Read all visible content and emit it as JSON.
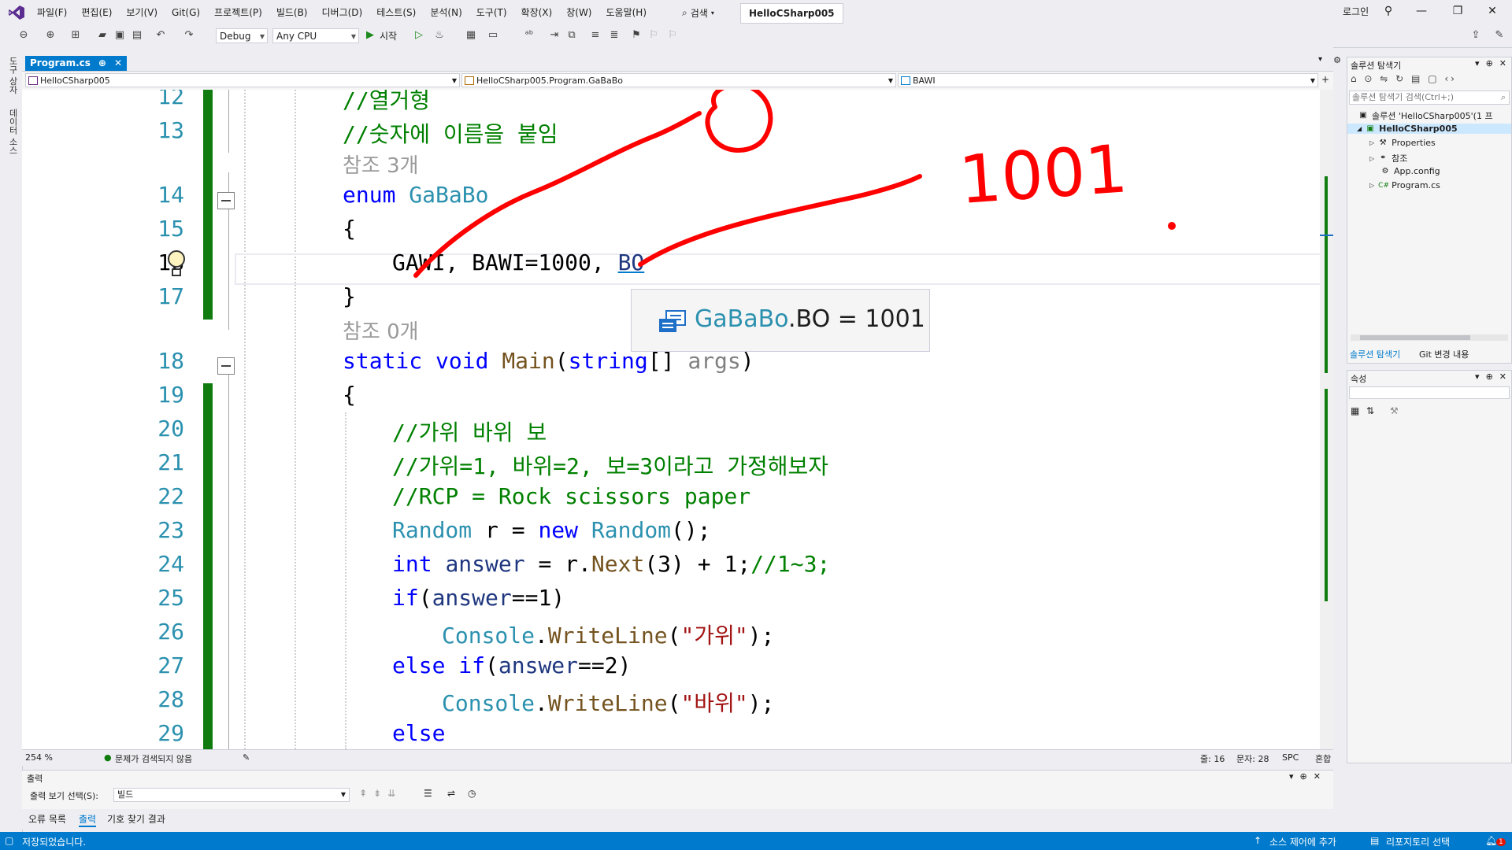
{
  "menu": {
    "items": [
      "파일(F)",
      "편집(E)",
      "보기(V)",
      "Git(G)",
      "프로젝트(P)",
      "빌드(B)",
      "디버그(D)",
      "테스트(S)",
      "분석(N)",
      "도구(T)",
      "확장(X)",
      "창(W)",
      "도움말(H)"
    ],
    "search_label": "검색",
    "solution_name": "HelloCSharp005",
    "login": "로그인"
  },
  "toolbar": {
    "config": "Debug",
    "platform": "Any CPU",
    "start_label": "시작"
  },
  "side_strip": [
    "도구 상자",
    "데이터 소스"
  ],
  "editor": {
    "tab_label": "Program.cs",
    "tab_pin": "⊕",
    "tab_close": "✕",
    "nav_project": "HelloCSharp005",
    "nav_class": "HelloCSharp005.Program.GaBaBo",
    "nav_member": "BAWI",
    "ref_3": "참조 3개",
    "ref_0": "참조 0개",
    "line_numbers": [
      "12",
      "13",
      "14",
      "15",
      "16",
      "17",
      "18",
      "19",
      "20",
      "21",
      "22",
      "23",
      "24",
      "25",
      "26",
      "27",
      "28",
      "29"
    ],
    "lines": {
      "l12": "//열거형",
      "l13": "//숫자에 이름을 붙임",
      "l14_kw": "enum",
      "l14_ty": "GaBaBo",
      "l15": "{",
      "l16_a": "GAWI, BAWI=1000, ",
      "l16_b": "BO",
      "l17": "}",
      "l18_kw1": "static",
      "l18_kw2": "void",
      "l18_me": "Main",
      "l18_p1": "(",
      "l18_kw3": "string",
      "l18_p2": "[] ",
      "l18_arg": "args",
      "l18_p3": ")",
      "l19": "{",
      "l20": "//가위 바위 보",
      "l21": "//가위=1, 바위=2, 보=3이라고 가정해보자",
      "l22": "//RCP = Rock scissors paper",
      "l23_ty1": "Random",
      "l23_a": " r = ",
      "l23_kw": "new",
      "l23_b": " ",
      "l23_ty2": "Random",
      "l23_c": "();",
      "l24_kw": "int",
      "l24_a": " ",
      "l24_v": "answer",
      "l24_b": " = r.",
      "l24_me": "Next",
      "l24_c": "(3) + 1;",
      "l24_cm": "//1~3;",
      "l25_kw": "if",
      "l25_a": "(",
      "l25_v": "answer",
      "l25_b": "==1)",
      "l26_ty": "Console",
      "l26_a": ".",
      "l26_me": "WriteLine",
      "l26_b": "(",
      "l26_st": "\"가위\"",
      "l26_c": ");",
      "l27_kw1": "else",
      "l27_kw2": "if",
      "l27_a": "(",
      "l27_v": "answer",
      "l27_b": "==2)",
      "l28_ty": "Console",
      "l28_a": ".",
      "l28_me": "WriteLine",
      "l28_b": "(",
      "l28_st": "\"바위\"",
      "l28_c": ");",
      "l29_kw": "else"
    },
    "tooltip": {
      "type": "GaBaBo",
      "rest": ".BO = 1001"
    },
    "annotation": "1001"
  },
  "editor_status": {
    "zoom": "254 %",
    "issues": "문제가 검색되지 않음",
    "line": "줄: 16",
    "col": "문자: 28",
    "spc": "SPC",
    "eol": "혼합"
  },
  "solution_explorer": {
    "title": "솔루션 탐색기",
    "search_placeholder": "솔루션 탐색기 검색(Ctrl+;)",
    "solution_row": "솔루션 'HelloCSharp005'(1 프",
    "project": "HelloCSharp005",
    "items": [
      "Properties",
      "참조",
      "App.config",
      "Program.cs"
    ],
    "tab_active": "솔루션 탐색기",
    "tab_other": "Git 변경 내용"
  },
  "properties": {
    "title": "속성"
  },
  "output": {
    "title": "출력",
    "source_label": "출력 보기 선택(S):",
    "source_value": "빌드"
  },
  "bottom_tabs": [
    "오류 목록",
    "출력",
    "기호 찾기 결과"
  ],
  "statusbar": {
    "message": "저장되었습니다.",
    "add_source": "소스 제어에 추가",
    "repo": "리포지토리 선택",
    "notif": "1"
  },
  "colors": {
    "accent": "#007acc",
    "change_bar": "#107c10",
    "ink": "#ff0000"
  }
}
